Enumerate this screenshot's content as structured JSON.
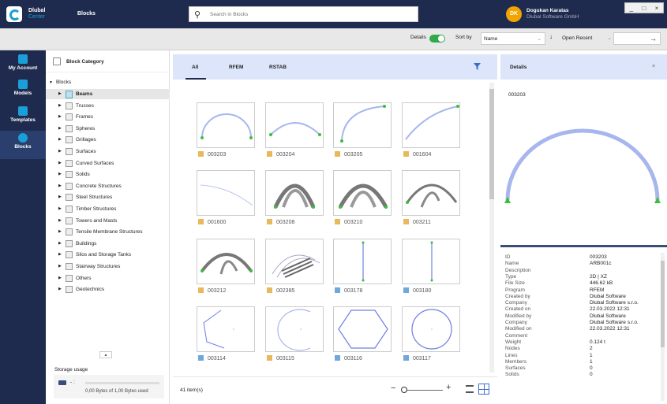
{
  "app": {
    "name": "Dlubal",
    "name_sub": "Center",
    "window_title": "Blocks"
  },
  "search": {
    "placeholder": "Search in Blocks"
  },
  "user": {
    "initials": "DK",
    "name": "Dogukan Karatas",
    "org": "Dlubal Software GmbH"
  },
  "window_controls": [
    "_",
    "□",
    "×"
  ],
  "toolbar": {
    "details_label": "Details",
    "details_on": true,
    "sortby_label": "Sort by",
    "sort_value": "Name",
    "sort_direction_icon": "arrow-down-icon",
    "open_recent_label": "Open Recent",
    "arrow_right": "→"
  },
  "sidebar": {
    "items": [
      {
        "label": "My Account",
        "icon": "account-icon"
      },
      {
        "label": "Models",
        "icon": "cube-icon"
      },
      {
        "label": "Templates",
        "icon": "template-icon"
      },
      {
        "label": "Blocks",
        "icon": "block-icon",
        "active": true
      }
    ]
  },
  "category": {
    "title": "Block Category",
    "root": "Blocks",
    "items": [
      "Beams",
      "Trusses",
      "Frames",
      "Spheres",
      "Grillages",
      "Surfaces",
      "Curved Surfaces",
      "Solids",
      "Concrete Structures",
      "Steel Structures",
      "Timber Structures",
      "Towers and Masts",
      "Tensile Membrane Structures",
      "Buildings",
      "Silos and Storage Tanks",
      "Stairway Structures",
      "Others",
      "Geotechnics"
    ],
    "active_index": 0,
    "collapse_arrow": "▲"
  },
  "storage": {
    "label": "Storage usage",
    "drive": "- :",
    "usage": "0,00 Bytes of 1,00 Bytes used"
  },
  "tabs": [
    "All",
    "RFEM",
    "RSTAB"
  ],
  "active_tab": 0,
  "cards": [
    {
      "id": "003203",
      "kind": "rfem"
    },
    {
      "id": "003204",
      "kind": "rfem"
    },
    {
      "id": "003205",
      "kind": "rfem"
    },
    {
      "id": "001604",
      "kind": "rfem"
    },
    {
      "id": "001600",
      "kind": "rfem"
    },
    {
      "id": "003208",
      "kind": "rfem"
    },
    {
      "id": "003210",
      "kind": "rfem"
    },
    {
      "id": "003211",
      "kind": "rfem"
    },
    {
      "id": "003212",
      "kind": "rfem"
    },
    {
      "id": "002385",
      "kind": "rfem"
    },
    {
      "id": "003178",
      "kind": "rstab"
    },
    {
      "id": "003180",
      "kind": "rstab"
    },
    {
      "id": "003114",
      "kind": "rstab"
    },
    {
      "id": "003115",
      "kind": "rfem"
    },
    {
      "id": "003116",
      "kind": "rstab"
    },
    {
      "id": "003117",
      "kind": "rstab"
    }
  ],
  "footer": {
    "count": "41 item(s)",
    "zoom_minus": "−",
    "zoom_plus": "+"
  },
  "details": {
    "title": "Details",
    "close": "×",
    "selected_id": "003203",
    "properties": [
      {
        "k": "ID",
        "v": "003203"
      },
      {
        "k": "Name",
        "v": "ARB001c"
      },
      {
        "k": "Description",
        "v": ""
      },
      {
        "k": "Type",
        "v": "2D | XZ"
      },
      {
        "k": "File Size",
        "v": "446.62 kB"
      },
      {
        "k": "Program",
        "v": "RFEM"
      },
      {
        "k": "Created by",
        "v": "Dlubal Software"
      },
      {
        "k": "Company",
        "v": "Dlubal Software s.r.o."
      },
      {
        "k": "Created on",
        "v": "22.03.2022 12:31"
      },
      {
        "k": "Modified by",
        "v": "Dlubal Software"
      },
      {
        "k": "Company",
        "v": "Dlubal Software s.r.o."
      },
      {
        "k": "Modified on",
        "v": "22.03.2022 12:31"
      },
      {
        "k": "Comment",
        "v": ""
      },
      {
        "k": "Weight",
        "v": "0.124 t"
      },
      {
        "k": "Nodes",
        "v": "2"
      },
      {
        "k": "Lines",
        "v": "1"
      },
      {
        "k": "Members",
        "v": "1"
      },
      {
        "k": "Surfaces",
        "v": "0"
      },
      {
        "k": "Solids",
        "v": "0"
      }
    ]
  },
  "colors": {
    "nav": "#1e2b4f",
    "accent": "#1a9fd8",
    "tab_bg": "#dde5fb",
    "arch": "#a8b6ee",
    "support": "#3bbf3b"
  }
}
